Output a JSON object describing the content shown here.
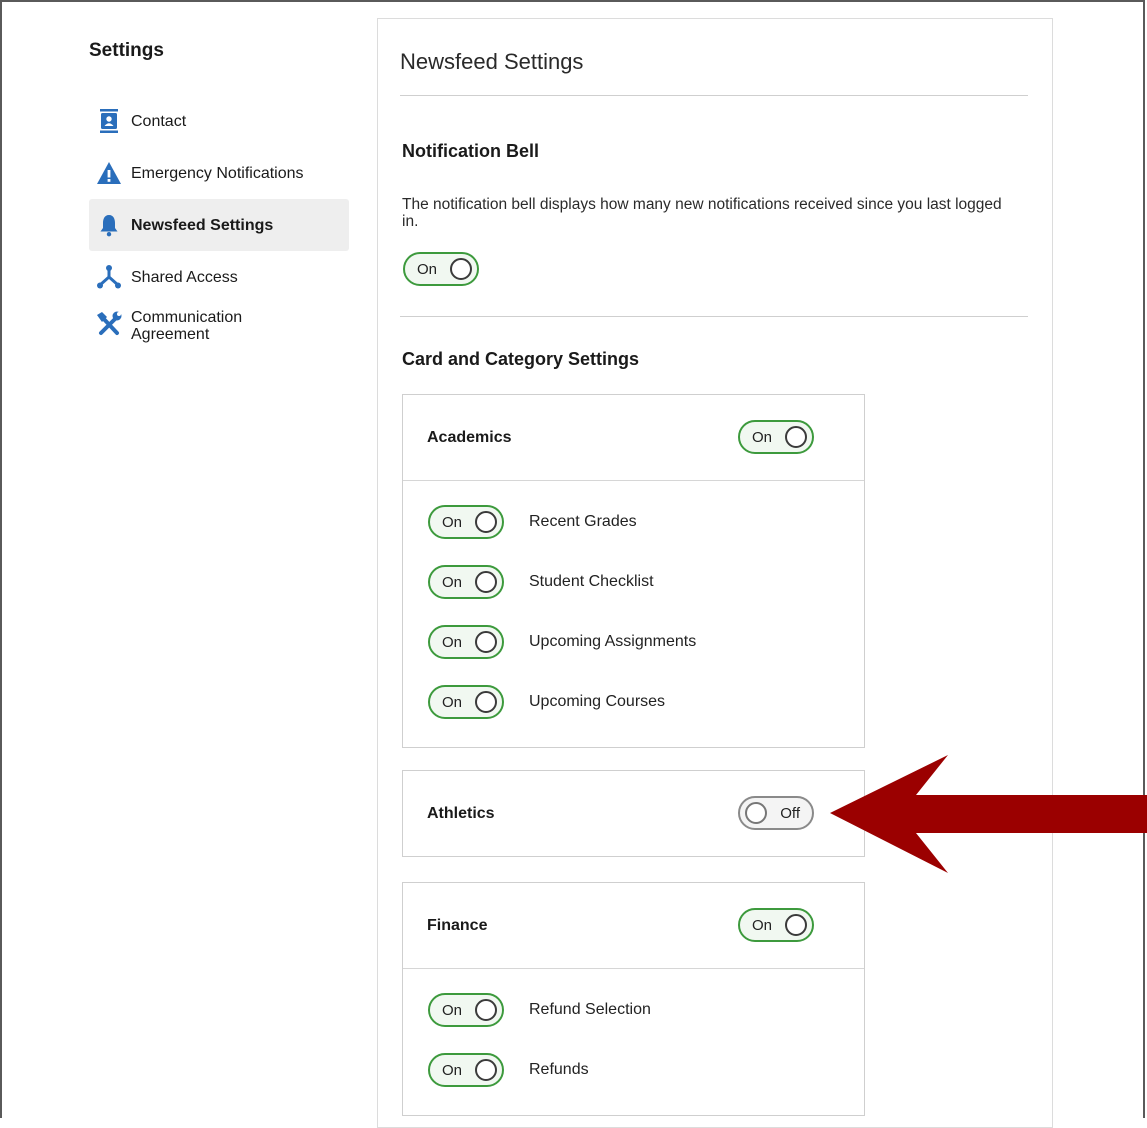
{
  "sidebar": {
    "title": "Settings",
    "items": [
      {
        "label": "Contact",
        "icon": "contact-icon"
      },
      {
        "label": "Emergency Notifications",
        "icon": "warning-icon"
      },
      {
        "label": "Newsfeed Settings",
        "icon": "bell-icon",
        "active": true
      },
      {
        "label": "Shared Access",
        "icon": "share-icon"
      },
      {
        "label": "Communication Agreement",
        "icon": "tools-icon"
      }
    ]
  },
  "main": {
    "title": "Newsfeed Settings",
    "bell": {
      "heading": "Notification Bell",
      "description": "The notification bell displays how many new notifications received since you last logged in.",
      "toggle": "On"
    },
    "cards_heading": "Card and Category Settings",
    "cards": [
      {
        "title": "Academics",
        "toggle": "On",
        "items": [
          {
            "label": "Recent Grades",
            "toggle": "On"
          },
          {
            "label": "Student Checklist",
            "toggle": "On"
          },
          {
            "label": "Upcoming Assignments",
            "toggle": "On"
          },
          {
            "label": "Upcoming Courses",
            "toggle": "On"
          }
        ]
      },
      {
        "title": "Athletics",
        "toggle": "Off",
        "items": []
      },
      {
        "title": "Finance",
        "toggle": "On",
        "items": [
          {
            "label": "Refund Selection",
            "toggle": "On"
          },
          {
            "label": "Refunds",
            "toggle": "On"
          }
        ]
      }
    ]
  },
  "colors": {
    "accent_blue": "#2a6ebb",
    "toggle_on": "#3d9a3d",
    "toggle_off": "#8a8a8a",
    "annotation_arrow": "#9b0000"
  }
}
